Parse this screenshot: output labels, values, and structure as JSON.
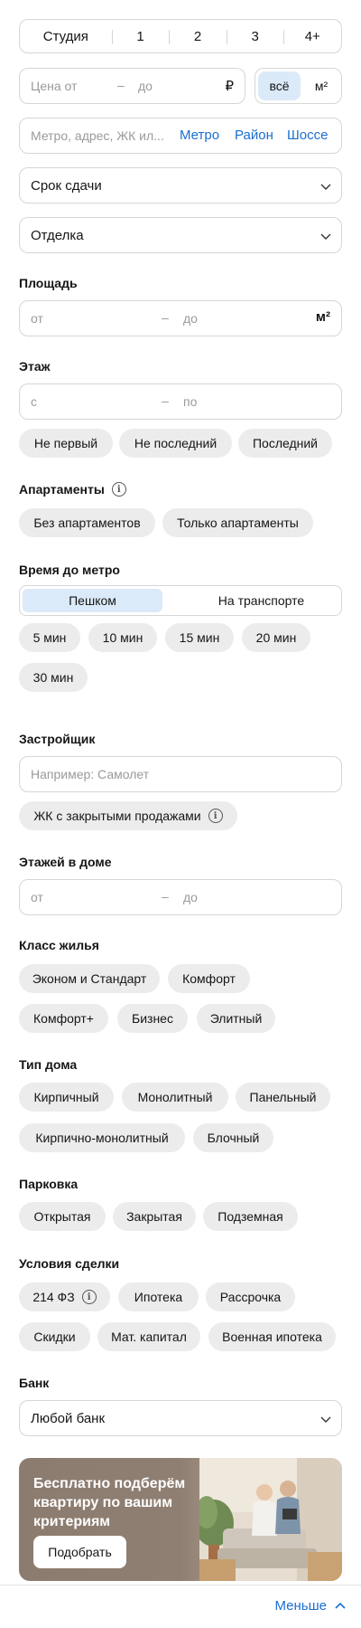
{
  "rooms": [
    "Студия",
    "1",
    "2",
    "3",
    "4+"
  ],
  "price": {
    "from_placeholder": "Цена от",
    "dash": "–",
    "to_placeholder": "до",
    "currency": "₽",
    "unit_all": "всё",
    "unit_m2": "м²"
  },
  "location": {
    "placeholder": "Метро, адрес, ЖК ил...",
    "metro": "Метро",
    "district": "Район",
    "highway": "Шоссе"
  },
  "deadline": {
    "label": "Срок сдачи"
  },
  "finish": {
    "label": "Отделка"
  },
  "area": {
    "title": "Площадь",
    "from": "от",
    "dash": "–",
    "to": "до",
    "unit": "м²"
  },
  "floor": {
    "title": "Этаж",
    "from": "с",
    "dash": "–",
    "to": "по",
    "options": [
      "Не первый",
      "Не последний",
      "Последний"
    ]
  },
  "apartments": {
    "title": "Апартаменты",
    "options": [
      "Без апартаментов",
      "Только апартаменты"
    ]
  },
  "metro_time": {
    "title": "Время до метро",
    "modes": [
      "Пешком",
      "На транспорте"
    ],
    "options": [
      "5 мин",
      "10 мин",
      "15 мин",
      "20 мин",
      "30 мин"
    ]
  },
  "developer": {
    "title": "Застройщик",
    "placeholder": "Например: Самолет",
    "closed_sales": "ЖК с закрытыми продажами"
  },
  "floors_in_house": {
    "title": "Этажей в доме",
    "from": "от",
    "dash": "–",
    "to": "до"
  },
  "housing_class": {
    "title": "Класс жилья",
    "options": [
      "Эконом и Стандарт",
      "Комфорт",
      "Комфорт+",
      "Бизнес",
      "Элитный"
    ]
  },
  "house_type": {
    "title": "Тип дома",
    "options": [
      "Кирпичный",
      "Монолитный",
      "Панельный",
      "Кирпично-монолитный",
      "Блочный"
    ]
  },
  "parking": {
    "title": "Парковка",
    "options": [
      "Открытая",
      "Закрытая",
      "Подземная"
    ]
  },
  "deal_terms": {
    "title": "Условия сделки",
    "options": [
      "214 ФЗ",
      "Ипотека",
      "Рассрочка",
      "Скидки",
      "Мат. капитал",
      "Военная ипотека"
    ]
  },
  "bank": {
    "title": "Банк",
    "value": "Любой банк"
  },
  "promo": {
    "text": "Бесплатно подберём квартиру по вашим критериям",
    "button": "Подобрать"
  },
  "footer": {
    "less": "Меньше"
  },
  "colors": {
    "accent": "#1a6fd0",
    "chip_bg": "#ececec",
    "selected_bg": "#dbeaf8",
    "promo_bg": "#8a7a6e"
  }
}
